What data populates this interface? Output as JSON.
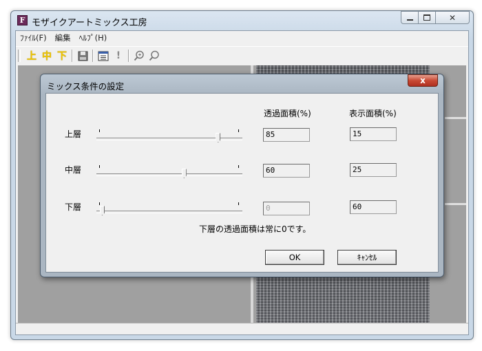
{
  "window": {
    "title": "モザイクアートミックス工房",
    "icon_letter": "F"
  },
  "menu": [
    "ﾌｧｲﾙ(F)",
    "編集",
    "ﾍﾙﾌﾟ(H)"
  ],
  "toolbar": {
    "top": "上",
    "middle": "中",
    "bottom": "下"
  },
  "dialog": {
    "title": "ミックス条件の設定",
    "close_glyph": "x",
    "col_transparent": "透過面積(%)",
    "col_display": "表示面積(%)",
    "rows": [
      {
        "label": "上層",
        "transparent": "85",
        "display": "15",
        "slider_fraction": 0.85,
        "transparent_disabled": false
      },
      {
        "label": "中層",
        "transparent": "60",
        "display": "25",
        "slider_fraction": 0.6,
        "transparent_disabled": false
      },
      {
        "label": "下層",
        "transparent": "0",
        "display": "60",
        "slider_fraction": 0.0,
        "transparent_disabled": true
      }
    ],
    "note": "下層の透過面積は常に0です。",
    "ok_label": "OK",
    "cancel_label": "ｷｬﾝｾﾙ"
  }
}
